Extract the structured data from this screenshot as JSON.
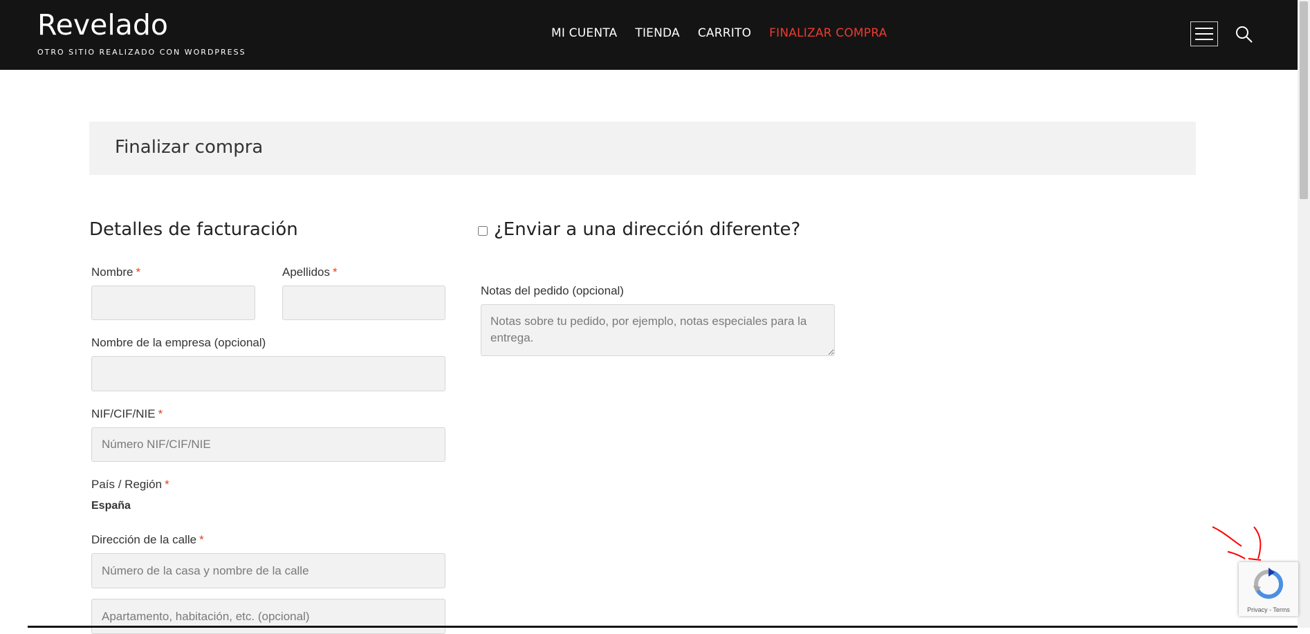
{
  "header": {
    "site_title": "Revelado",
    "tagline": "OTRO SITIO REALIZADO CON WORDPRESS",
    "nav": [
      {
        "label": "MI CUENTA",
        "active": false
      },
      {
        "label": "TIENDA",
        "active": false
      },
      {
        "label": "CARRITO",
        "active": false
      },
      {
        "label": "FINALIZAR COMPRA",
        "active": true
      }
    ],
    "menu_icon": "hamburger-icon",
    "search_icon": "search-icon"
  },
  "page": {
    "title": "Finalizar compra"
  },
  "billing": {
    "heading": "Detalles de facturación",
    "first_name": {
      "label": "Nombre",
      "required": "*",
      "value": "",
      "placeholder": ""
    },
    "last_name": {
      "label": "Apellidos",
      "required": "*",
      "value": "",
      "placeholder": ""
    },
    "company": {
      "label": "Nombre de la empresa (opcional)",
      "value": "",
      "placeholder": ""
    },
    "nif": {
      "label": "NIF/CIF/NIE",
      "required": "*",
      "value": "",
      "placeholder": "Número NIF/CIF/NIE"
    },
    "country": {
      "label": "País / Región",
      "required": "*",
      "value": "España"
    },
    "street": {
      "label": "Dirección de la calle",
      "required": "*",
      "placeholder": "Número de la casa y nombre de la calle",
      "placeholder2": "Apartamento, habitación, etc. (opcional)"
    }
  },
  "shipping": {
    "heading": "¿Enviar a una dirección diferente?",
    "checked": false,
    "notes": {
      "label": "Notas del pedido (opcional)",
      "placeholder": "Notas sobre tu pedido, por ejemplo, notas especiales para la entrega."
    }
  },
  "recaptcha": {
    "links": "Privacy - Terms",
    "icon": "recaptcha-icon"
  },
  "colors": {
    "header_bg": "#141414",
    "accent": "#ec3b2f",
    "required": "#e2401c",
    "field_bg": "#f2f2f2",
    "annotation": "#ff0000"
  }
}
